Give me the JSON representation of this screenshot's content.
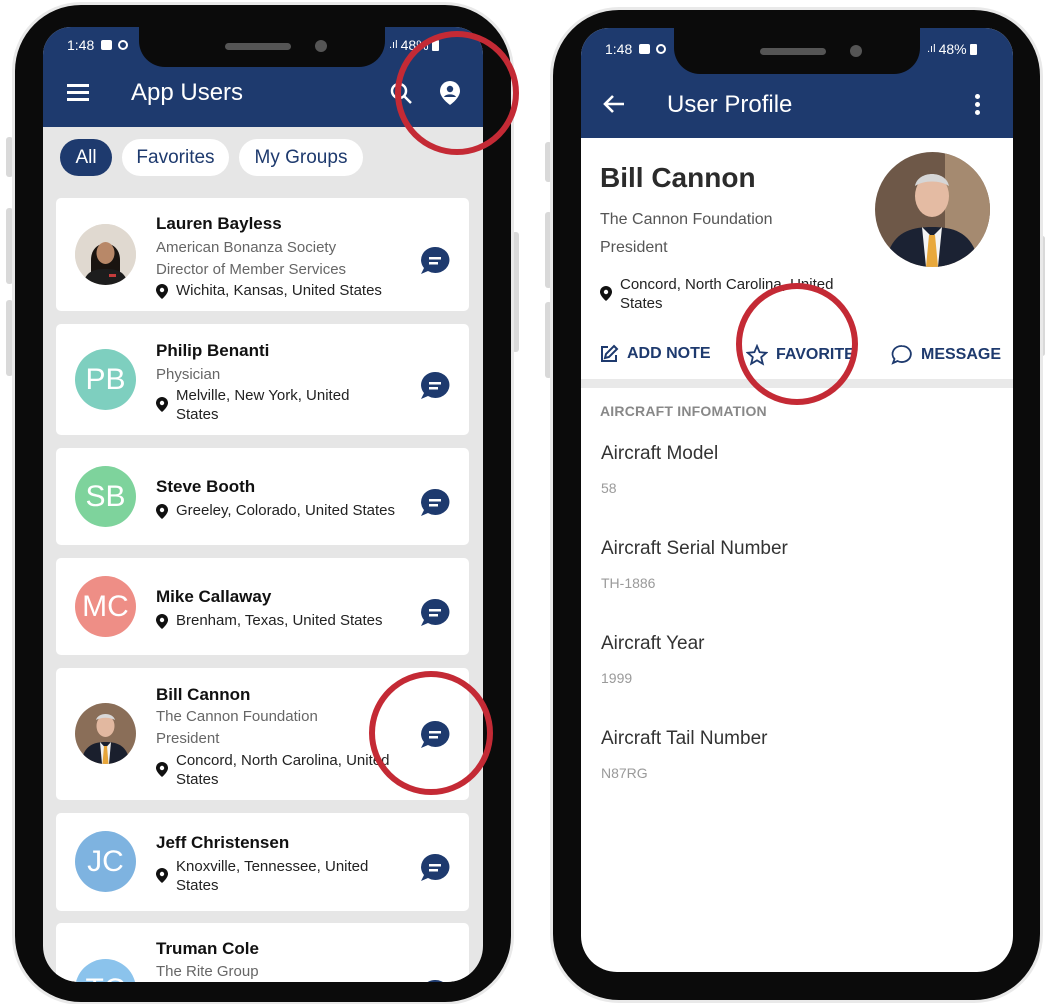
{
  "colors": {
    "brand": "#1e3a6e",
    "highlight_ring": "#c42a35",
    "list_bg": "#e6e6e6"
  },
  "left_phone": {
    "status": {
      "time": "1:48",
      "battery": "48%"
    },
    "header": {
      "title": "App Users",
      "menu_icon": "hamburger-icon",
      "search_icon": "search-icon",
      "profile_icon": "user-circle-icon"
    },
    "filters": [
      "All",
      "Favorites",
      "My Groups"
    ],
    "users": [
      {
        "name": "Lauren Bayless",
        "org": "American Bonanza Society",
        "role": "Director of Member Services",
        "location": "Wichita, Kansas, United States",
        "avatar": "photo"
      },
      {
        "name": "Philip Benanti",
        "org": "Physician",
        "location": "Melville, New York, United States",
        "initials": "PB",
        "color": "#7ecfbf"
      },
      {
        "name": "Steve Booth",
        "location": "Greeley, Colorado, United States",
        "initials": "SB",
        "color": "#7ed39c"
      },
      {
        "name": "Mike Callaway",
        "location": "Brenham, Texas, United States",
        "initials": "MC",
        "color": "#ee8e86"
      },
      {
        "name": "Bill Cannon",
        "org": "The Cannon Foundation",
        "role": "President",
        "location": "Concord, North Carolina, United States",
        "avatar": "photo"
      },
      {
        "name": "Jeff Christensen",
        "location": "Knoxville, Tennessee, United States",
        "initials": "JC",
        "color": "#7eb3e0"
      },
      {
        "name": "Truman Cole",
        "org": "The Rite Group",
        "initials": "TC",
        "color": "#8bc3ec"
      }
    ]
  },
  "right_phone": {
    "status": {
      "time": "1:48",
      "battery": "48%"
    },
    "header": {
      "title": "User Profile",
      "back_icon": "arrow-left-icon",
      "more_icon": "more-vertical-icon"
    },
    "profile": {
      "name": "Bill Cannon",
      "org": "The Cannon Foundation",
      "role": "President",
      "location": "Concord, North Carolina, United States"
    },
    "actions": {
      "add_note": "ADD NOTE",
      "favorite": "FAVORITE",
      "message": "MESSAGE"
    },
    "section_title": "AIRCRAFT INFOMATION",
    "fields": [
      {
        "label": "Aircraft Model",
        "value": "58"
      },
      {
        "label": "Aircraft Serial Number",
        "value": "TH-1886"
      },
      {
        "label": "Aircraft Year",
        "value": "1999"
      },
      {
        "label": "Aircraft Tail Number",
        "value": "N87RG"
      }
    ]
  }
}
